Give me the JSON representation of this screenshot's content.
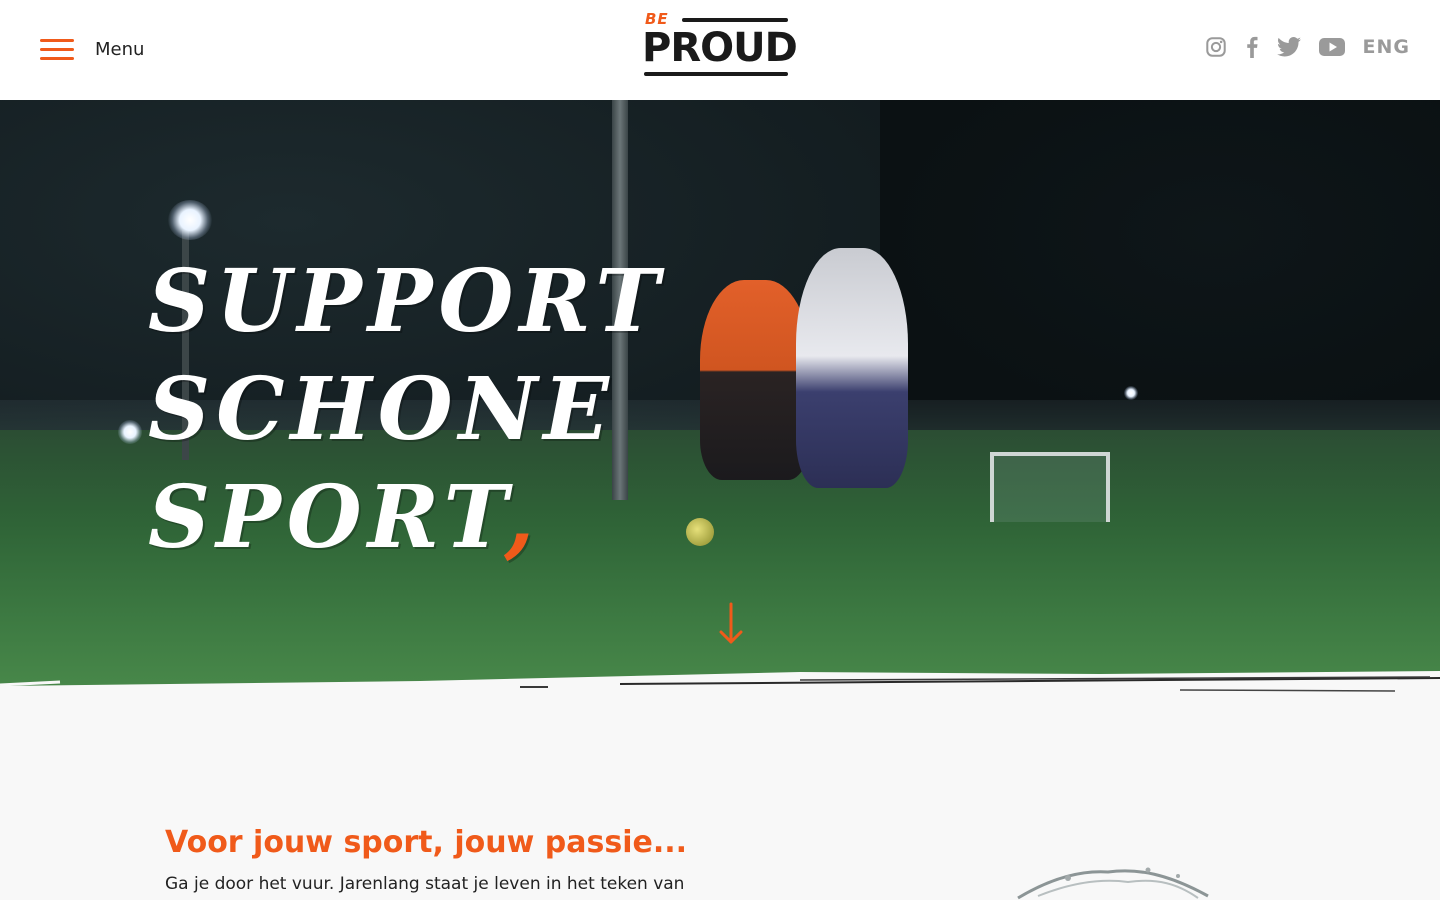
{
  "header": {
    "menu_label": "Menu",
    "logo": {
      "be": "BE",
      "proud": "PROUD"
    },
    "socials": [
      "instagram-icon",
      "facebook-icon",
      "twitter-icon",
      "youtube-icon"
    ],
    "lang": "ENG"
  },
  "hero": {
    "line1": "Support",
    "line2": "schone",
    "line3": "sport",
    "dot": ","
  },
  "intro": {
    "title": "Voor jouw sport, jouw passie...",
    "text": "Ga je door het vuur. Jarenlang staat je leven in het teken van"
  },
  "colors": {
    "accent": "#f05a1a",
    "dark": "#1a1a1a",
    "social_gray": "#9a9a9a"
  }
}
